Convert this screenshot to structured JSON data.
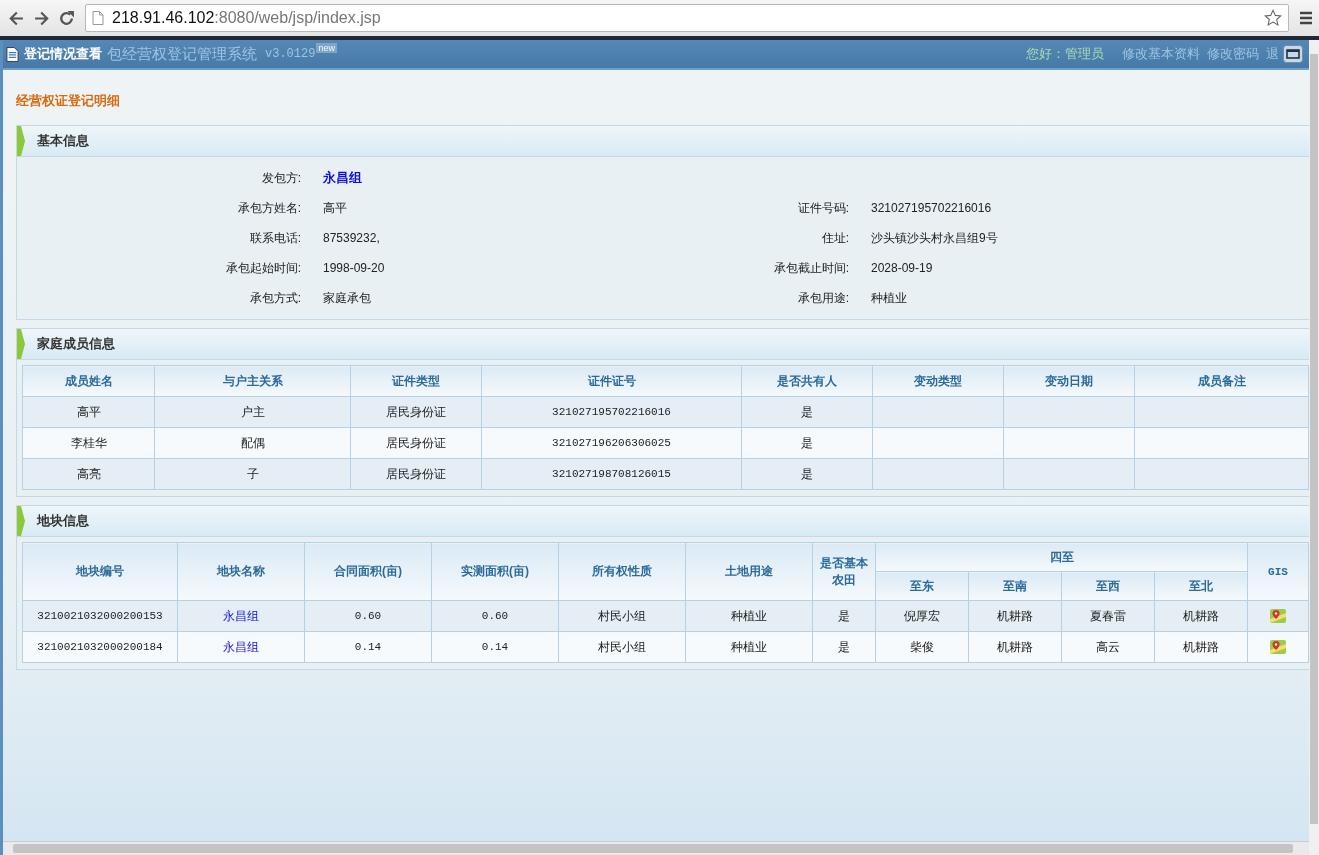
{
  "browser": {
    "url_host": "218.91.46.102",
    "url_rest": ":8080/web/jsp/index.jsp"
  },
  "app_header": {
    "title": "包经营权登记管理系统",
    "version": "v3.0129",
    "badge": "new",
    "greeting": "您好：",
    "user": "管理员",
    "links": [
      "修改基本资料",
      "修改密码",
      "退"
    ]
  },
  "dialog": {
    "title": "登记情况查看"
  },
  "page_title": "经营权证登记明细",
  "basic_info": {
    "title": "基本信息",
    "rows": [
      [
        {
          "label": "发包方:",
          "value": "永昌组",
          "link": true
        }
      ],
      [
        {
          "label": "承包方姓名:",
          "value": "高平",
          "link": false
        },
        {
          "label": "证件号码:",
          "value": "321027195702216016",
          "link": false
        }
      ],
      [
        {
          "label": "联系电话:",
          "value": "87539232,",
          "link": false
        },
        {
          "label": "住址:",
          "value": "沙头镇沙头村永昌组9号",
          "link": false
        }
      ],
      [
        {
          "label": "承包起始时间:",
          "value": "1998-09-20",
          "link": false
        },
        {
          "label": "承包截止时间:",
          "value": "2028-09-19",
          "link": false
        }
      ],
      [
        {
          "label": "承包方式:",
          "value": "家庭承包",
          "link": false
        },
        {
          "label": "承包用途:",
          "value": "种植业",
          "link": false
        }
      ]
    ]
  },
  "family": {
    "title": "家庭成员信息",
    "columns": [
      "成员姓名",
      "与户主关系",
      "证件类型",
      "证件证号",
      "是否共有人",
      "变动类型",
      "变动日期",
      "成员备注"
    ],
    "rows": [
      [
        "高平",
        "户主",
        "居民身份证",
        "321027195702216016",
        "是"
      ],
      [
        "李桂华",
        "配偶",
        "居民身份证",
        "321027196206306025",
        "是"
      ],
      [
        "高亮",
        "子",
        "居民身份证",
        "321027198708126015",
        "是"
      ]
    ]
  },
  "plots": {
    "title": "地块信息",
    "columns": [
      "地块编号",
      "地块名称",
      "合同面积(亩)",
      "实测面积(亩)",
      "所有权性质",
      "土地用途",
      "是否基本农田"
    ],
    "group": "四至",
    "group_columns": [
      "至东",
      "至南",
      "至西",
      "至北"
    ],
    "last_column": "GIS",
    "rows": [
      {
        "cells": [
          "3210021032000200153",
          "永昌组",
          "0.60",
          "0.60",
          "村民小组",
          "种植业",
          "是",
          "倪厚宏",
          "机耕路",
          "夏春雷",
          "机耕路"
        ],
        "gis": true
      },
      {
        "cells": [
          "3210021032000200184",
          "永昌组",
          "0.14",
          "0.14",
          "村民小组",
          "种植业",
          "是",
          "柴俊",
          "机耕路",
          "高云",
          "机耕路"
        ],
        "gis": true
      }
    ]
  }
}
